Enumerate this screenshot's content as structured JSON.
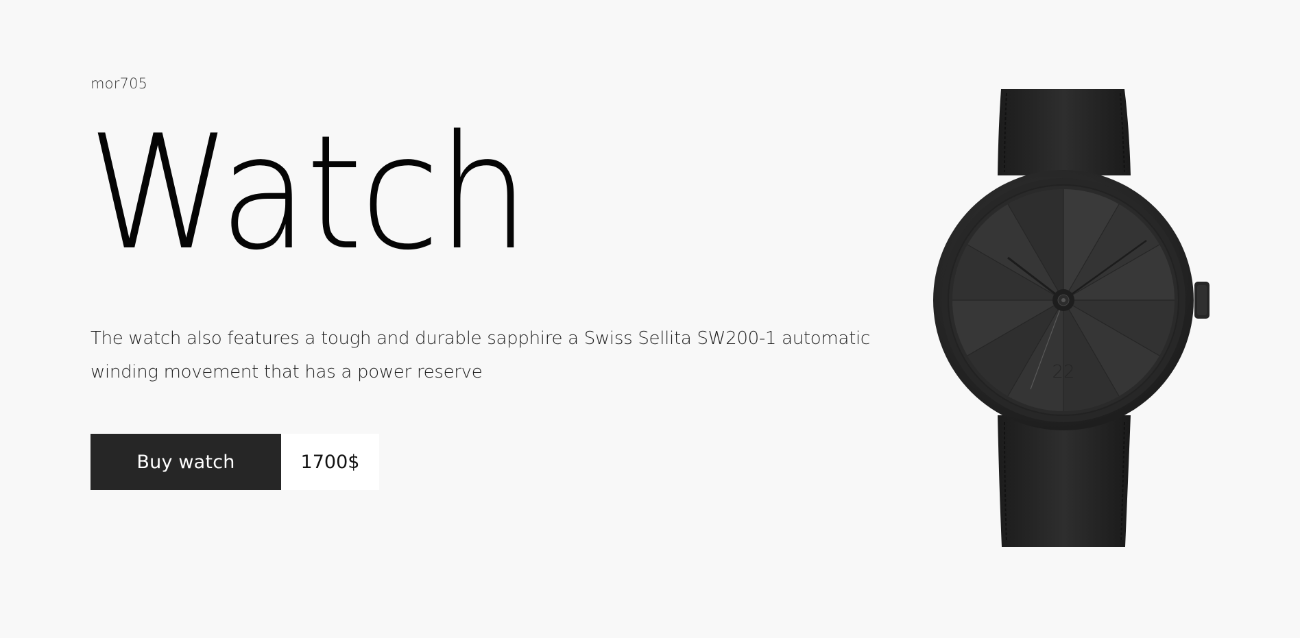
{
  "brand": "mor705",
  "headline": "Watch",
  "description": "The watch also features a tough and durable sapphire a Swiss Sellita SW200-1 automatic winding movement that has a power reserve",
  "cta": {
    "buy_label": "Buy watch",
    "price": "1700$"
  },
  "watch_image": {
    "dial_number": "22"
  },
  "colors": {
    "background": "#f8f8f8",
    "button": "#262626",
    "button_text": "#ffffff",
    "price_bg": "#ffffff",
    "text": "#050505"
  }
}
